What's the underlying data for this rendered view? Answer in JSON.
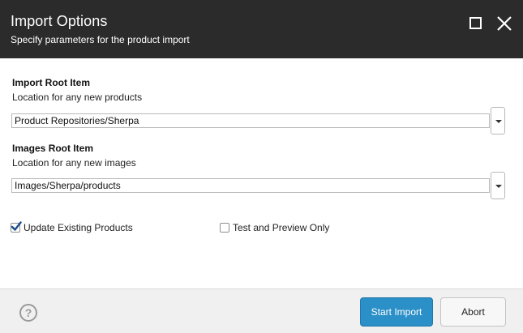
{
  "dialog": {
    "title": "Import Options",
    "subtitle": "Specify parameters for the product import"
  },
  "import_root": {
    "title": "Import Root Item",
    "description": "Location for any new products",
    "value": "Product Repositories/Sherpa"
  },
  "images_root": {
    "title": "Images Root Item",
    "description": "Location for any new images",
    "value": "Images/Sherpa/products"
  },
  "options": {
    "update_existing": {
      "label": "Update Existing Products",
      "checked": true
    },
    "test_preview": {
      "label": "Test and Preview Only",
      "checked": false
    }
  },
  "footer": {
    "help_icon_text": "?",
    "start_label": "Start Import",
    "abort_label": "Abort"
  },
  "colors": {
    "header_bg": "#2b2b2b",
    "primary_button": "#2b8fc8",
    "footer_bg": "#f0f0f0",
    "checkmark": "#1a4e8a"
  },
  "icons": [
    "maximize-icon",
    "close-icon",
    "chevron-down-icon",
    "checkmark-icon",
    "help-icon"
  ]
}
